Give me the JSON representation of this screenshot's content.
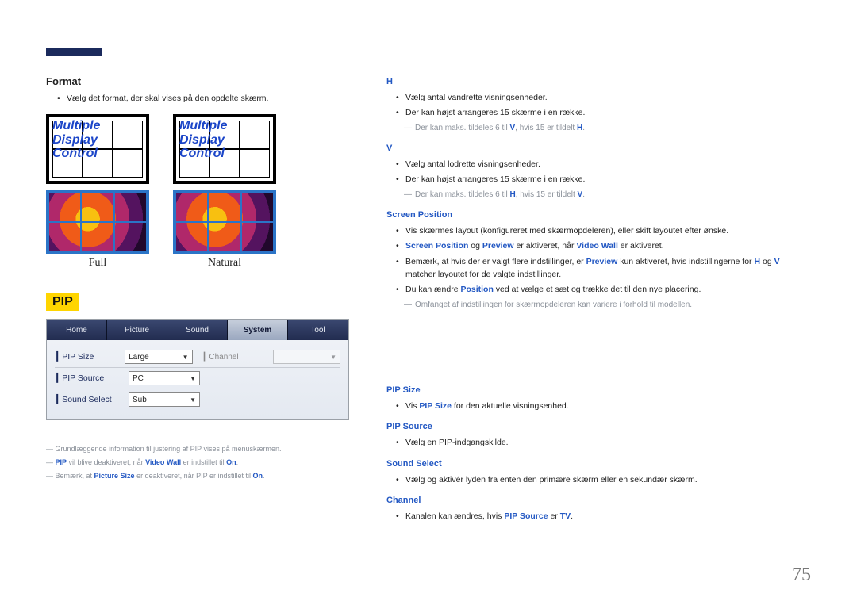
{
  "page_number": "75",
  "format": {
    "heading": "Format",
    "desc": "Vælg det format, der skal vises på den opdelte skærm.",
    "mdc_text": "Multiple\nDisplay\nControl",
    "caption_full": "Full",
    "caption_natural": "Natural"
  },
  "right": {
    "h": {
      "heading": "H",
      "items": [
        "Vælg antal vandrette visningsenheder.",
        "Der kan højst arrangeres 15 skærme i en række."
      ],
      "note_pre": "Der kan maks. tildeles 6 til ",
      "note_key1": "V",
      "note_mid": ", hvis 15 er tildelt ",
      "note_key2": "H",
      "note_post": "."
    },
    "v": {
      "heading": "V",
      "items": [
        "Vælg antal lodrette visningsenheder.",
        "Der kan højst arrangeres 15 skærme i en række."
      ],
      "note_pre": "Der kan maks. tildeles 6 til ",
      "note_key1": "H",
      "note_mid": ", hvis 15 er tildelt ",
      "note_key2": "V",
      "note_post": "."
    },
    "screen_position": {
      "heading": "Screen Position",
      "items": {
        "a": "Vis skærmes layout (konfigureret med skærmopdeleren), eller skift layoutet efter ønske.",
        "b_sp": "Screen Position",
        "b_og": " og ",
        "b_pv": "Preview",
        "b_rest": " er aktiveret, når ",
        "b_vw": "Video Wall",
        "b_end": " er aktiveret.",
        "c_pre": "Bemærk, at hvis der er valgt flere indstillinger, er ",
        "c_pv": "Preview",
        "c_mid": " kun aktiveret, hvis indstillingerne for ",
        "c_h": "H",
        "c_og": " og ",
        "c_v": "V",
        "c_end": " matcher layoutet for de valgte indstillinger.",
        "d_pre": "Du kan ændre ",
        "d_pos": "Position",
        "d_end": " ved at vælge et sæt og trække det til den nye placering."
      },
      "note": "Omfanget af indstillingen for skærmopdeleren kan variere i forhold til modellen."
    },
    "pip_size": {
      "heading": "PIP Size",
      "item_pre": "Vis ",
      "item_key": "PIP Size",
      "item_post": " for den aktuelle visningsenhed."
    },
    "pip_source": {
      "heading": "PIP Source",
      "item": "Vælg en PIP-indgangskilde."
    },
    "sound_select": {
      "heading": "Sound Select",
      "item": "Vælg og aktivér lyden fra enten den primære skærm eller en sekundær skærm."
    },
    "channel": {
      "heading": "Channel",
      "item_pre": "Kanalen kan ændres, hvis ",
      "item_key": "PIP Source",
      "item_mid": " er ",
      "item_tv": "TV",
      "item_post": "."
    }
  },
  "pip": {
    "badge": "PIP",
    "tabs": [
      "Home",
      "Picture",
      "Sound",
      "System",
      "Tool"
    ],
    "rows": {
      "size_label": "PIP Size",
      "size_value": "Large",
      "channel_label": "Channel",
      "source_label": "PIP Source",
      "source_value": "PC",
      "sound_label": "Sound Select",
      "sound_value": "Sub"
    }
  },
  "footnotes": {
    "a": "Grundlæggende information til justering af  PIP vises på menuskærmen.",
    "b_pre": "PIP",
    "b_mid": " vil blive deaktiveret, når ",
    "b_vw": "Video Wall",
    "b_rest": " er indstillet til ",
    "b_on": "On",
    "b_end": ".",
    "c_pre": "Bemærk, at ",
    "c_ps": "Picture Size",
    "c_rest": " er deaktiveret, når PIP er indstillet til ",
    "c_on": "On",
    "c_end": "."
  }
}
